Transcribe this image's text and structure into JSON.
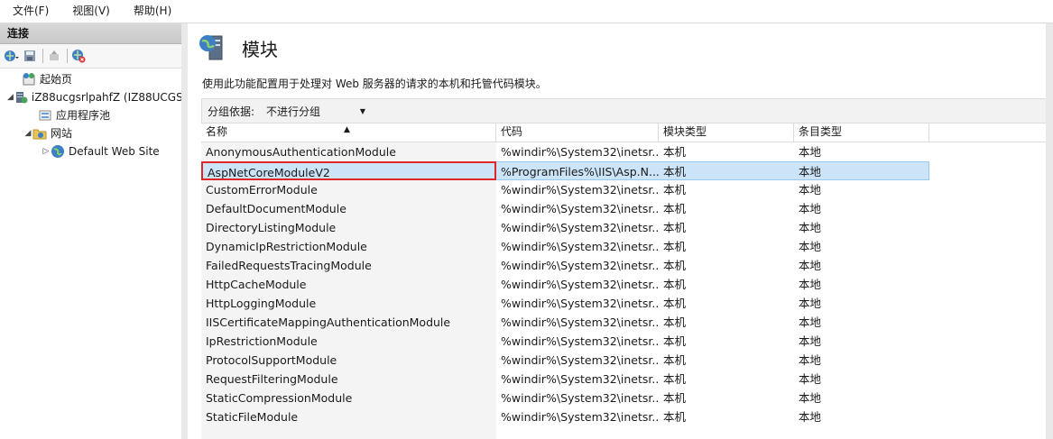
{
  "menu": [
    {
      "label": "文件(F)"
    },
    {
      "label": "视图(V)"
    },
    {
      "label": "帮助(H)"
    }
  ],
  "left_pane": {
    "title": "连接",
    "tree": [
      {
        "label": "起始页",
        "icon": "start-page-icon",
        "level": 1,
        "toggle": ""
      },
      {
        "label": "iZ88ucgsrlpahfZ (IZ88UCGS",
        "icon": "server-icon",
        "level": 0,
        "toggle": "◢"
      },
      {
        "label": "应用程序池",
        "icon": "app-pool-icon",
        "level": 1,
        "toggle": ""
      },
      {
        "label": "网站",
        "icon": "sites-folder-icon",
        "level": 1,
        "toggle": "◢"
      },
      {
        "label": "Default Web Site",
        "icon": "globe-icon",
        "level": 2,
        "toggle": "▷"
      }
    ]
  },
  "page": {
    "title": "模块",
    "description": "使用此功能配置用于处理对 Web 服务器的请求的本机和托管代码模块。",
    "group_label": "分组依据:",
    "group_value": "不进行分组"
  },
  "table": {
    "headers": [
      "名称",
      "代码",
      "模块类型",
      "条目类型"
    ],
    "rows": [
      [
        "AnonymousAuthenticationModule",
        "%windir%\\System32\\inetsr...",
        "本机",
        "本地"
      ],
      [
        "AspNetCoreModuleV2",
        "%ProgramFiles%\\IIS\\Asp.N...",
        "本机",
        "本地"
      ],
      [
        "CustomErrorModule",
        "%windir%\\System32\\inetsr...",
        "本机",
        "本地"
      ],
      [
        "DefaultDocumentModule",
        "%windir%\\System32\\inetsr...",
        "本机",
        "本地"
      ],
      [
        "DirectoryListingModule",
        "%windir%\\System32\\inetsr...",
        "本机",
        "本地"
      ],
      [
        "DynamicIpRestrictionModule",
        "%windir%\\System32\\inetsr...",
        "本机",
        "本地"
      ],
      [
        "FailedRequestsTracingModule",
        "%windir%\\System32\\inetsr...",
        "本机",
        "本地"
      ],
      [
        "HttpCacheModule",
        "%windir%\\System32\\inetsr...",
        "本机",
        "本地"
      ],
      [
        "HttpLoggingModule",
        "%windir%\\System32\\inetsr...",
        "本机",
        "本地"
      ],
      [
        "IISCertificateMappingAuthenticationModule",
        "%windir%\\System32\\inetsr...",
        "本机",
        "本地"
      ],
      [
        "IpRestrictionModule",
        "%windir%\\System32\\inetsr...",
        "本机",
        "本地"
      ],
      [
        "ProtocolSupportModule",
        "%windir%\\System32\\inetsr...",
        "本机",
        "本地"
      ],
      [
        "RequestFilteringModule",
        "%windir%\\System32\\inetsr...",
        "本机",
        "本地"
      ],
      [
        "StaticCompressionModule",
        "%windir%\\System32\\inetsr...",
        "本机",
        "本地"
      ],
      [
        "StaticFileModule",
        "%windir%\\System32\\inetsr...",
        "本机",
        "本地"
      ]
    ],
    "selected_row": 1
  },
  "colors": {
    "selection": "#cce4f7",
    "highlight_border": "#e0262b"
  }
}
